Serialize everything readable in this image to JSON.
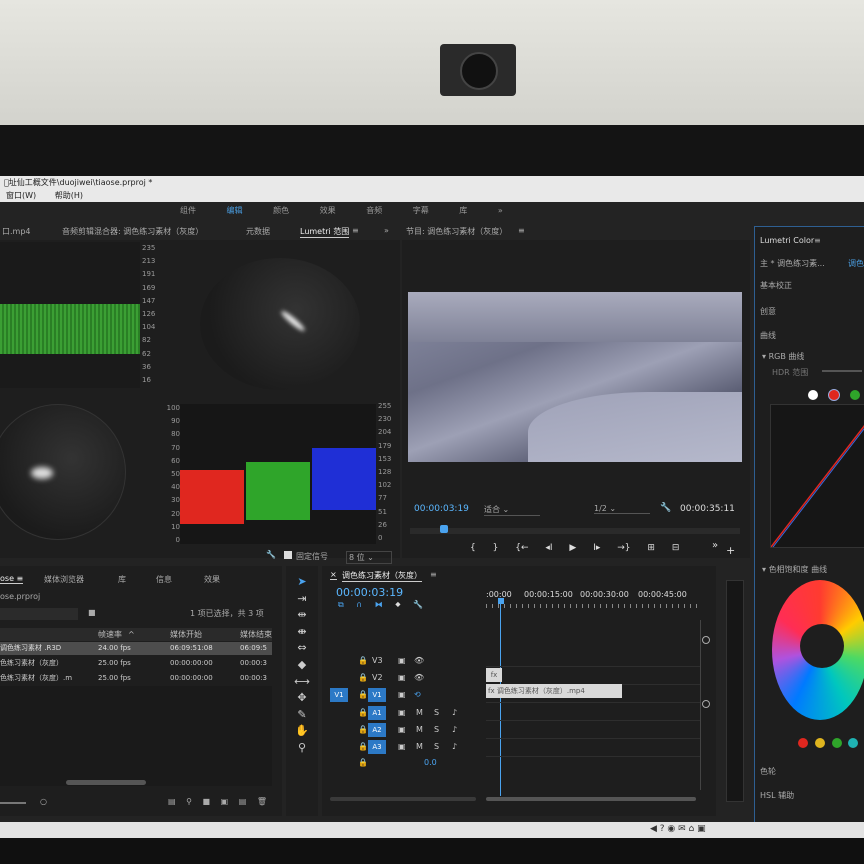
{
  "window": {
    "title": "\u0000址仙工概文件\\duojiwei\\tiaose.prproj *"
  },
  "menu": [
    "窗口(W)",
    "帮助(H)"
  ],
  "workspaces": [
    "组件",
    "编辑",
    "颜色",
    "效果",
    "音频",
    "字幕",
    "库"
  ],
  "workspace_active": "编辑",
  "top_tabs": {
    "left": "口.mp4",
    "source": "音频剪辑混合器: 调色练习素材（灰度）",
    "metadata": "元数据",
    "lumetri_scopes": "Lumetri 范围",
    "program": "节目: 调色练习素材（灰度）"
  },
  "scopes": {
    "waveform_left_ticks": [
      "235",
      "213",
      "191",
      "169",
      "147",
      "126",
      "104",
      "82",
      "62",
      "36",
      "16"
    ],
    "parade_left_ticks": [
      "100",
      "90",
      "80",
      "70",
      "60",
      "50",
      "40",
      "30",
      "20",
      "10",
      "0"
    ],
    "parade_right_ticks": [
      "255",
      "230",
      "204",
      "179",
      "153",
      "128",
      "102",
      "77",
      "51",
      "26",
      "0"
    ],
    "clamp_label": "固定信号",
    "bit_depth": "8 位"
  },
  "program_monitor": {
    "timecode": "00:00:03:19",
    "fit": "适合",
    "resolution": "1/2",
    "duration": "00:00:35:11",
    "playhead_fraction": 0.09
  },
  "project_panel": {
    "tabs": [
      "ose",
      "媒体浏览器",
      "库",
      "信息",
      "效果"
    ],
    "project_file": "ose.prproj",
    "selection_info": "1 项已选择，共 3 项",
    "columns": [
      "帧速率",
      "媒体开始",
      "媒体结束"
    ],
    "rows": [
      {
        "name": "调色练习素材 .R3D",
        "fps": "24.00 fps",
        "start": "06:09:51:08",
        "end": "06:09:5"
      },
      {
        "name": "色练习素材（灰度）",
        "fps": "25.00 fps",
        "start": "00:00:00:00",
        "end": "00:00:3"
      },
      {
        "name": "色练习素材（灰度）.m",
        "fps": "25.00 fps",
        "start": "00:00:00:00",
        "end": "00:00:3"
      }
    ]
  },
  "timeline": {
    "sequence": "调色练习素材（灰度）",
    "timecode": "00:00:03:19",
    "ruler": [
      ":00:00",
      "00:00:15:00",
      "00:00:30:00",
      "00:00:45:00"
    ],
    "video_tracks": [
      "V3",
      "V2",
      "V1"
    ],
    "audio_tracks": [
      "A1",
      "A2",
      "A3"
    ],
    "source_patch": "V1",
    "track_letters": {
      "mute": "M",
      "solo": "S"
    },
    "master_value": "0.0",
    "clip_name": "调色练习素材（灰度）.mp4",
    "clip_badge": "fx"
  },
  "lumetri": {
    "title": "Lumetri Color",
    "source": "主 * 调色练习素...",
    "sections": [
      "基本校正",
      "创意",
      "曲线"
    ],
    "rgb_curves": "RGB 曲线",
    "hdr": "HDR 范围",
    "hue_sat": "色相饱和度 曲线",
    "wheels": "色轮",
    "hsl": "HSL 辅助"
  },
  "colors": {
    "accent": "#2c79c6",
    "timecode": "#5bb7ff",
    "red": "#e0271f",
    "green": "#2fa52a",
    "blue": "#1f2fd6"
  }
}
